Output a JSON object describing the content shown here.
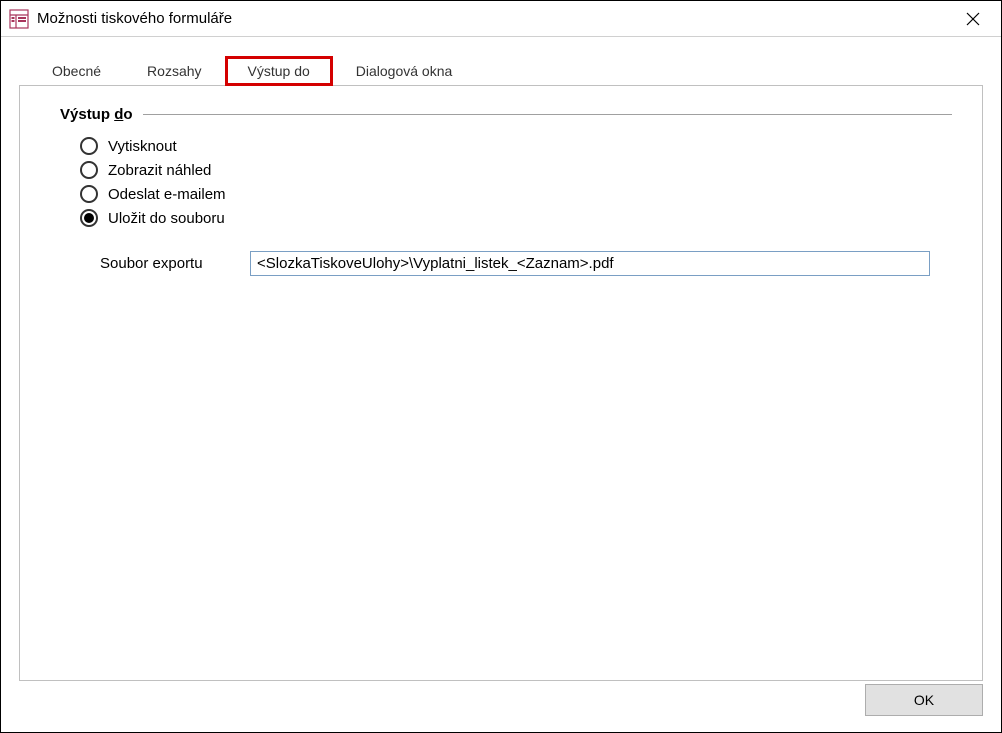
{
  "window": {
    "title": "Možnosti tiskového formuláře"
  },
  "tabs": {
    "general": "Obecné",
    "ranges": "Rozsahy",
    "output_to": "Výstup do",
    "dialog_windows": "Dialogová okna",
    "active": "output_to"
  },
  "section": {
    "title_prefix": "Výstup ",
    "title_underlined": "d",
    "title_suffix": "o"
  },
  "radios": {
    "print": "Vytisknout",
    "preview": "Zobrazit náhled",
    "email": "Odeslat e-mailem",
    "save_file": "Uložit do souboru",
    "selected": "save_file"
  },
  "export_file": {
    "label": "Soubor exportu",
    "value": "<SlozkaTiskoveUlohy>\\Vyplatni_listek_<Zaznam>.pdf"
  },
  "buttons": {
    "ok": "OK"
  }
}
